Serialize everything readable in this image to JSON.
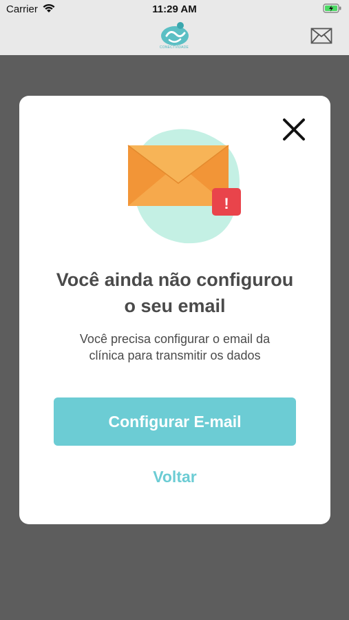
{
  "status_bar": {
    "carrier": "Carrier",
    "time": "11:29 AM",
    "icons": [
      "wifi-icon",
      "battery-charging-icon"
    ]
  },
  "nav_bar": {
    "logo_text": "CONECTVIDADE",
    "right_icon": "mail-icon"
  },
  "modal": {
    "close_icon": "close-icon",
    "illustration_icon": "envelope-alert-icon",
    "alert_mark": "!",
    "title_line1": "Você ainda não configurou",
    "title_line2": "o seu email",
    "subtitle_line1": "Você precisa configurar o email da",
    "subtitle_line2": "clínica para transmitir os dados",
    "primary_button": "Configurar E-mail",
    "secondary_link": "Voltar"
  },
  "colors": {
    "accent": "#6cccd4",
    "blob": "#c4f0e4",
    "envelope": "#f7a848",
    "alert": "#e9444b",
    "overlay": "#5d5d5d"
  }
}
